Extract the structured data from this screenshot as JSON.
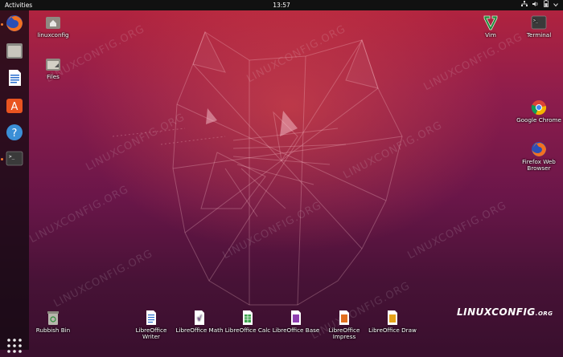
{
  "topbar": {
    "activities": "Activities",
    "clock": "13:57"
  },
  "dock": {
    "items": [
      "firefox-icon",
      "files-icon",
      "writer-icon",
      "software-icon",
      "help-icon",
      "terminal-icon"
    ],
    "colors": {
      "accent": "#f37a30"
    }
  },
  "desktop": {
    "icons": {
      "linuxconfig": "linuxconfig",
      "files": "Files",
      "vim": "Vim",
      "terminal": "Terminal",
      "chrome": "Google Chrome",
      "firefox": "Firefox Web Browser",
      "rubbish": "Rubbish Bin",
      "writer": "LibreOffice Writer",
      "math": "LibreOffice Math",
      "calc": "LibreOffice Calc",
      "base": "LibreOffice Base",
      "impress": "LibreOffice Impress",
      "draw": "LibreOffice Draw"
    },
    "watermark": "LINUXCONFIG.ORG",
    "brand": {
      "main": "LINUXCONFIG",
      "suffix": ".ORG"
    }
  }
}
